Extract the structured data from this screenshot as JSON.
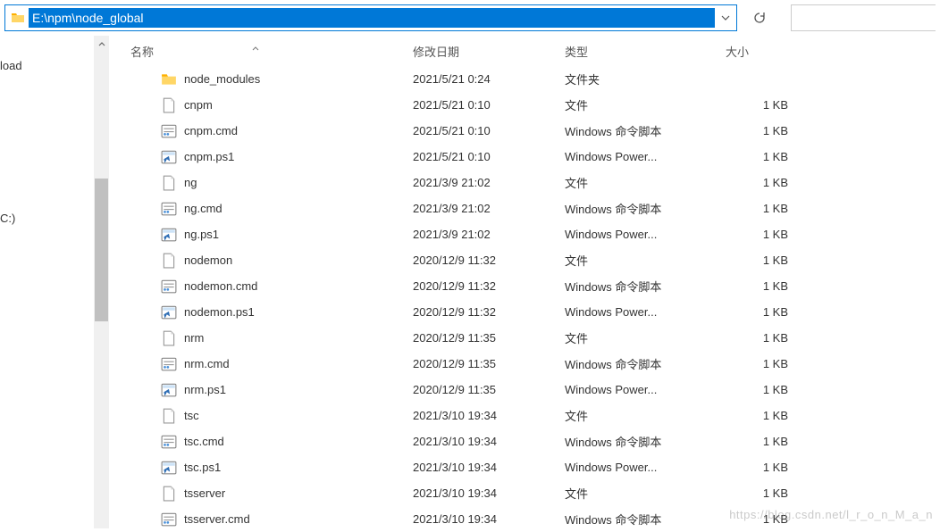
{
  "address": {
    "path": "E:\\npm\\node_global"
  },
  "sidebar": {
    "items": [
      {
        "label": "load"
      },
      {
        "label": ""
      },
      {
        "label": ""
      },
      {
        "label": ""
      },
      {
        "label": ""
      },
      {
        "label": ""
      },
      {
        "label": ""
      },
      {
        "label": ""
      },
      {
        "label": ""
      },
      {
        "label": ""
      },
      {
        "label": ""
      },
      {
        "label": ""
      },
      {
        "label": ""
      },
      {
        "label": "C:)"
      }
    ]
  },
  "columns": {
    "name": "名称",
    "date": "修改日期",
    "type": "类型",
    "size": "大小"
  },
  "files": [
    {
      "icon": "folder",
      "name": "node_modules",
      "date": "2021/5/21 0:24",
      "type": "文件夹",
      "size": ""
    },
    {
      "icon": "file",
      "name": "cnpm",
      "date": "2021/5/21 0:10",
      "type": "文件",
      "size": "1 KB"
    },
    {
      "icon": "cmd",
      "name": "cnpm.cmd",
      "date": "2021/5/21 0:10",
      "type": "Windows 命令脚本",
      "size": "1 KB"
    },
    {
      "icon": "ps1",
      "name": "cnpm.ps1",
      "date": "2021/5/21 0:10",
      "type": "Windows Power...",
      "size": "1 KB"
    },
    {
      "icon": "file",
      "name": "ng",
      "date": "2021/3/9 21:02",
      "type": "文件",
      "size": "1 KB"
    },
    {
      "icon": "cmd",
      "name": "ng.cmd",
      "date": "2021/3/9 21:02",
      "type": "Windows 命令脚本",
      "size": "1 KB"
    },
    {
      "icon": "ps1",
      "name": "ng.ps1",
      "date": "2021/3/9 21:02",
      "type": "Windows Power...",
      "size": "1 KB"
    },
    {
      "icon": "file",
      "name": "nodemon",
      "date": "2020/12/9 11:32",
      "type": "文件",
      "size": "1 KB"
    },
    {
      "icon": "cmd",
      "name": "nodemon.cmd",
      "date": "2020/12/9 11:32",
      "type": "Windows 命令脚本",
      "size": "1 KB"
    },
    {
      "icon": "ps1",
      "name": "nodemon.ps1",
      "date": "2020/12/9 11:32",
      "type": "Windows Power...",
      "size": "1 KB"
    },
    {
      "icon": "file",
      "name": "nrm",
      "date": "2020/12/9 11:35",
      "type": "文件",
      "size": "1 KB"
    },
    {
      "icon": "cmd",
      "name": "nrm.cmd",
      "date": "2020/12/9 11:35",
      "type": "Windows 命令脚本",
      "size": "1 KB"
    },
    {
      "icon": "ps1",
      "name": "nrm.ps1",
      "date": "2020/12/9 11:35",
      "type": "Windows Power...",
      "size": "1 KB"
    },
    {
      "icon": "file",
      "name": "tsc",
      "date": "2021/3/10 19:34",
      "type": "文件",
      "size": "1 KB"
    },
    {
      "icon": "cmd",
      "name": "tsc.cmd",
      "date": "2021/3/10 19:34",
      "type": "Windows 命令脚本",
      "size": "1 KB"
    },
    {
      "icon": "ps1",
      "name": "tsc.ps1",
      "date": "2021/3/10 19:34",
      "type": "Windows Power...",
      "size": "1 KB"
    },
    {
      "icon": "file",
      "name": "tsserver",
      "date": "2021/3/10 19:34",
      "type": "文件",
      "size": "1 KB"
    },
    {
      "icon": "cmd",
      "name": "tsserver.cmd",
      "date": "2021/3/10 19:34",
      "type": "Windows 命令脚本",
      "size": "1 KB"
    }
  ],
  "watermark": "https://blog.csdn.net/l_r_o_n_M_a_n"
}
